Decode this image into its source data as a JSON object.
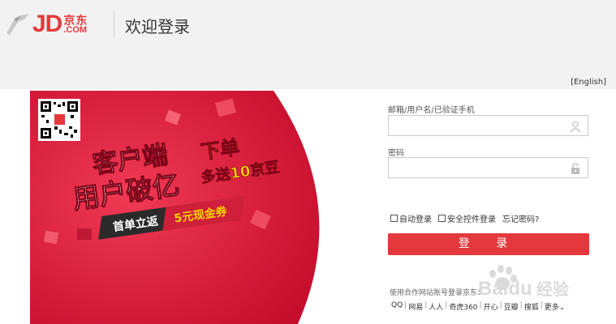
{
  "header": {
    "logo": {
      "jd": "JD",
      "cn": "京东",
      "com": ".COM"
    },
    "title": "欢迎登录"
  },
  "lang_link": "[English]",
  "banner": {
    "line1": "客户端",
    "line2": "用户破亿",
    "promo1": "下单",
    "promo2": "多送10京豆",
    "coupon_left": "首单立返",
    "coupon_right": "5元现金券",
    "accent": "#e4393c",
    "gold": "#f7d400"
  },
  "login": {
    "account_label": "邮箱/用户名/已验证手机",
    "account_value": "",
    "password_label": "密码",
    "password_value": "",
    "auto_login": "自动登录",
    "secure_login": "安全控件登录",
    "forgot": "忘记密码?",
    "submit": "登 录",
    "partner_text": "使用合作网站账号登录京东：",
    "partners": [
      "QQ",
      "网易",
      "人人",
      "奇虎360",
      "开心",
      "豆瓣",
      "搜狐",
      "更多"
    ],
    "more_arrow": "⌄"
  },
  "watermark": {
    "brand": "Baidu",
    "cn": "经验"
  }
}
